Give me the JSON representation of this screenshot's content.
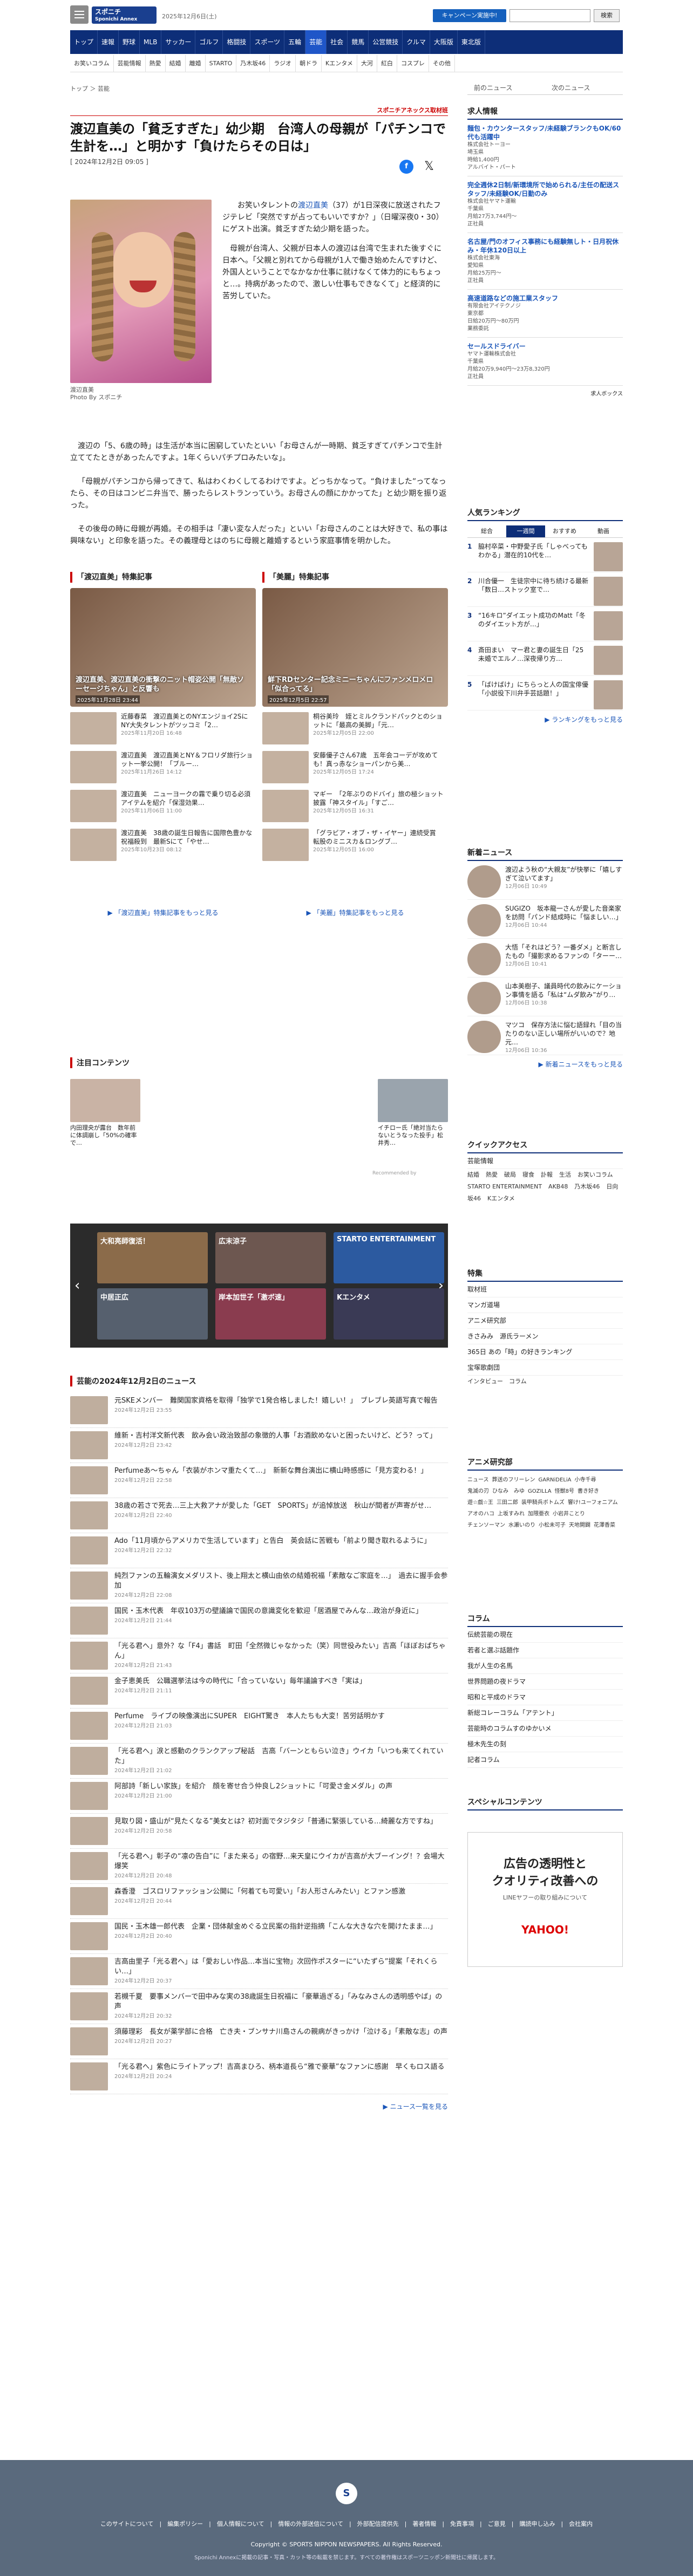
{
  "header": {
    "logo": "スポニチ",
    "logo_sub": "Sponichi Annex",
    "date": "2025年12月6日(土)",
    "campaign": "キャンペーン実施中!",
    "search_btn": "検索"
  },
  "nav1": [
    "トップ",
    "速報",
    "野球",
    "MLB",
    "サッカー",
    "ゴルフ",
    "格闘技",
    "スポーツ",
    "五輪",
    "芸能",
    "社会",
    "競馬",
    "公営競技",
    "クルマ",
    "大阪版",
    "東北版"
  ],
  "nav2": [
    "お笑いコラム",
    "芸能情報",
    "熱愛",
    "結婚",
    "離婚",
    "STARTO",
    "乃木坂46",
    "ラジオ",
    "朝ドラ",
    "Kエンタメ",
    "大河",
    "紅白",
    "コスプレ",
    "その他"
  ],
  "crumb": "トップ ＞ 芸能",
  "side_tabs": {
    "a": "前のニュース",
    "b": "次のニュース"
  },
  "article": {
    "tag": "スポニチアネックス取材班",
    "title": "渡辺直美の「貧乏すぎた」幼少期　台湾人の母親が「パチンコで生計を…」と明かす「負けたらその日は」",
    "date": "[ 2024年12月2日 09:05 ]",
    "caption1": "渡辺直美",
    "caption2": "Photo By スポニチ",
    "lead1a": "　お笑いタレントの",
    "lead1link": "渡辺直美",
    "lead1b": "（37）が1日深夜に放送されたフジテレビ「突然ですが占ってもいいですか？」（日曜深夜0・30）にゲスト出演。貧乏すぎた幼少期を語った。",
    "lead2": "母親が台湾人、父親が日本人の渡辺は台湾で生まれた後すぐに日本へ。「父親と別れてから母親が1人で働き始めたんですけど、外国人ということでなかなか仕事に就けなくて体力的にもちょっと…。持病があったので、激しい仕事もできなくて」と経済的に苦労していた。",
    "p1": "渡辺の「5、6歳の時」は生活が本当に困窮していたといい「お母さんが一時期、貧乏すぎてパチンコで生計立ててたときがあったんですよ。1年くらいパチプロみたいな」。",
    "p2": "「母親がパチンコから帰ってきて、私はわくわくしてるわけですよ。どっちかなって。“負けました”ってなったら、その日はコンビニ弁当で、勝ったらレストランっていう。お母さんの顔にかかってた」と幼少期を振り返った。",
    "p3": "その後母の時に母親が再婚。その相手は「凄い変な人だった」といい「お母さんのことは大好きで、私の事は興味ない」と印象を語った。その義理母とはのちに母親と離婚するという家庭事情を明かした。",
    "tag2": "スポニチアネックス取材班"
  },
  "feature_left": {
    "title": "「渡辺直美」特集記事",
    "hero": "渡辺直美、渡辺直美の衝撃のニット帽姿公開「無敵ソーセージちゃん」と反響も",
    "hero_date": "2025年11月28日 23:44",
    "items": [
      {
        "t": "近藤春菜　渡辺直美とのNYエンジョイ2SにNY大失タレントがツッコミ「2…",
        "d": "2025年11月20日 16:48"
      },
      {
        "t": "渡辺直美　渡辺直美とNY＆フロリダ旅行ショット一挙公開！「ブルー…",
        "d": "2025年11月26日 14:12"
      },
      {
        "t": "渡辺直美　ニューヨークの霧で乗り切る必須アイテムを紹介「保湿効果…",
        "d": "2025年11月06日 11:00"
      },
      {
        "t": "渡辺直美　38歳の誕生日報告に国際色豊かな祝福殺到　最新Sにて「やせ…",
        "d": "2025年10月23日 08:12"
      }
    ],
    "more": "「渡辺直美」特集記事をもっと見る"
  },
  "feature_right": {
    "title": "「美麗」特集記事",
    "hero": "鮮下RDセンター記念ミニーちゃんにファンメロメロ「似合ってる」",
    "hero_date": "2025年12月5日 22:57",
    "items": [
      {
        "t": "桐谷美玲　姪とミルクランドパックとのショットに「最高の美脚」「元…",
        "d": "2025年12月05日 22:00"
      },
      {
        "t": "安藤優子さん67歳　五年会コーデが攻めても！真っ赤なショーパンから美…",
        "d": "2025年12月05日 17:24"
      },
      {
        "t": "マギー　「2年ぶりのドバイ」旅の極ショット披露「神スタイル」「すご…",
        "d": "2025年12月05日 16:31"
      },
      {
        "t": "「グラビア・オブ・ザ・イヤー」連続受賞　転股のミニスカ＆ロングブ…",
        "d": "2025年12月05日 16:00"
      }
    ],
    "more": "「美麗」特集記事をもっと見る"
  },
  "notice": {
    "title": "注目コンテンツ",
    "a": "内田理央が露台　数年前に体調崩し「50%の確率で…",
    "b": "イチロー氏「絶対当たらないとうなった投手」松井秀…",
    "rec": "Recommended by"
  },
  "carousel": [
    "大和亮師復活！",
    "広末涼子",
    "STARTO ENTERTAINMENT",
    "中居正広",
    "岸本加世子「激ボ速」",
    "Kエンタメ"
  ],
  "news": {
    "title": "芸能の2024年12月2日のニュース",
    "items": [
      {
        "t": "元SKEメンバー　難関国家資格を取得「独学で1発合格しました！嬉しい！」　ブレブレ英語写真で報告",
        "d": "2024年12月2日 23:55"
      },
      {
        "t": "維新・吉村洋文新代表　飲み会い政治致部の象徴的人事「お酒飲めないと困ったいけど、どう？って」",
        "d": "2024年12月2日 23:42"
      },
      {
        "t": "Perfumeあ～ちゃん「衣装がホンマ重たくて…」　新新な舞台演出に横山時感感に「見方変わる！」",
        "d": "2024年12月2日 22:58"
      },
      {
        "t": "38歳の若さで死去…三上大救アナが愛した「GET　SPORTS」が追悼放送　秋山が間者が声寄がせ…",
        "d": "2024年12月2日 22:40"
      },
      {
        "t": "Ado「11月頃からアメリカで生活しています」と告白　英会話に苦戦も「前より聞き取れるように」",
        "d": "2024年12月2日 22:32"
      },
      {
        "t": "純烈ファンの五輪演女メダリスト、後上翔太と横山由依の結婚祝福「素敵なご家庭を…」　過去に握手会参加",
        "d": "2024年12月2日 22:08"
      },
      {
        "t": "国民・玉木代表　年収103万の壁議論で国民の意識変化を歓迎「居酒屋でみんな…政治が身近に」",
        "d": "2024年12月2日 21:44"
      },
      {
        "t": "「光る君へ」意外？な「F4」書話　町田「全然微じゃなかった（笑）同世役みたい」吉高「ほぼおばちゃん」",
        "d": "2024年12月2日 21:43"
      },
      {
        "t": "金子恵美氏　公職選挙法は今の時代に「合っていない」毎年議論すべき「実は」",
        "d": "2024年12月2日 21:11"
      },
      {
        "t": "Perfume　ライブの映像演出にSUPER　EIGHT驚き　本人たちも大変！苦労話明かす",
        "d": "2024年12月2日 21:03"
      },
      {
        "t": "「光る君へ」涙と感動のクランクアップ秘話　吉高「バーンともらい泣き」ウイカ「いつも来てくれていた」",
        "d": "2024年12月2日 21:02"
      },
      {
        "t": "阿部詩「新しい家族」を紹介　顔を寄せ合う仲良し2ショットに「可愛さ金メダル」の声",
        "d": "2024年12月2日 21:00"
      },
      {
        "t": "見取り図・盛山が“見たくなる”美女とは？初対面でタジタジ「普通に緊張している…綺麗な方ですね」",
        "d": "2024年12月2日 20:58"
      },
      {
        "t": "「光る君へ」彰子の“凛の告白”に「また来る」の宿野…来天皇にウイカが吉高が大ブーイング！？会場大爆笑",
        "d": "2024年12月2日 20:48"
      },
      {
        "t": "森香澄　ゴスロリファッション公開に「何着ても可愛い」「お人形さんみたい」とファン感激",
        "d": "2024年12月2日 20:44"
      },
      {
        "t": "国民・玉木雄一郎代表　企業・団体献金めぐる立民案の指針逆指摘「こんな大きな穴を開けたまま…」",
        "d": "2024年12月2日 20:40"
      },
      {
        "t": "吉高由里子「光る君へ」は「愛おしい作品…本当に宝物」次回作ポスターに“いたずら”提案「それくらい…」",
        "d": "2024年12月2日 20:37"
      },
      {
        "t": "若槻千夏　要事メンバーで田中みな実の38歳誕生日祝福に「豪華過ぎる」「みなみさんの透明感やば」の声",
        "d": "2024年12月2日 20:32"
      },
      {
        "t": "須藤理彩　長女が薬学部に合格　亡き夫・ブンサナ川島さんの親病がきっかけ「泣ける」「素敵な志」の声",
        "d": "2024年12月2日 20:27"
      },
      {
        "t": "「光る君へ」紫色にライトアップ！吉高まひろ、柄本道長ら“雅で豪華”なファンに感謝　早くもロス語る",
        "d": "2024年12月2日 20:24"
      }
    ],
    "more": "ニュース一覧を見る"
  },
  "jobs": {
    "title": "求人情報",
    "items": [
      {
        "t": "麺包・カウンタースタッフ/未経験ブランクもOK/60代も活躍中",
        "c": "株式会社トーヨー",
        "l": "埼玉県",
        "s": "時給1,400円",
        "e": "アルバイト・パート"
      },
      {
        "t": "完全週休2日制/新環境所で始められる/主任の配送スタッフ/未経験OK/日勤のみ",
        "c": "株式会社ヤマト運輸",
        "l": "千葉県",
        "s": "月給27万3,744円〜",
        "e": "正社員"
      },
      {
        "t": "名古屋/門のオフィス事務にも経験無しト・日月祝休み・年休120日以上",
        "c": "株式会社東海",
        "l": "愛知県",
        "s": "月給25万円〜",
        "e": "正社員"
      },
      {
        "t": "高速道路などの施工業スタッフ",
        "c": "有限会社アイテクノジ",
        "l": "東京都",
        "s": "日給20万円〜80万円",
        "e": "業務委託"
      },
      {
        "t": "セールスドライバー",
        "c": "ヤマト運輸株式会社",
        "l": "千葉県",
        "s": "月給20万9,940円〜23万8,320円",
        "e": "正社員"
      }
    ],
    "footer": "求人ボックス"
  },
  "ranking": {
    "title": "人気ランキング",
    "tabs": [
      "総合",
      "一週間",
      "おすすめ",
      "動画"
    ],
    "items": [
      {
        "n": "1",
        "t": "脇村卒菜・中野愛子氏「しゃべってもわかる」潜在的10代を…"
      },
      {
        "n": "2",
        "t": "川合優一　生徒宗中に待ち続ける最新「数日…ストック室で…"
      },
      {
        "n": "3",
        "t": "“16キロ”ダイエット成功のMatt「冬のダイエット方が…」"
      },
      {
        "n": "4",
        "t": "斎田まい　マー君と妻の誕生日「25　未婚でエルノ…深夜帰り方…"
      },
      {
        "n": "5",
        "t": "「ばけばけ」にちらっと人の国宝俳優「小説役下川弁手芸話題！」"
      }
    ],
    "more": "ランキングをもっと見る"
  },
  "newarrival": {
    "title": "新着ニュース",
    "items": [
      {
        "t": "渡辺よう秋の“大親友”が快挙に「嬉しすぎて泣いてます」",
        "d": "12月06日 10:49"
      },
      {
        "t": "SUGIZO　坂本龍一さんが愛した音楽家を訪問「パンド結成時に「悩ましい…」",
        "d": "12月06日 10:44"
      },
      {
        "t": "大悟「それはどう？一番ダメ」と断言したもの「撮影求めるファンの「ターー…",
        "d": "12月06日 10:41"
      },
      {
        "t": "山本美樹子、議員時代の飲みにケーション事情を語る「私は“ムダ飲み”がり…",
        "d": "12月06日 10:38"
      },
      {
        "t": "マツコ　保存方法に悩む語録れ「目の当たりのない正しい場所がいいので？地元…",
        "d": "12月06日 10:36"
      }
    ],
    "more": "新着ニュースをもっと見る"
  },
  "quick": {
    "title": "クイックアクセス",
    "head": "芸能情報",
    "links": [
      "結婚",
      "熱愛",
      "破局",
      "寝食",
      "訃報",
      "生活",
      "お笑いコラム"
    ],
    "tags": [
      "STARTO ENTERTAINMENT",
      "AKB48",
      "乃木坂46",
      "日向坂46",
      "Kエンタメ"
    ]
  },
  "special": {
    "title": "特集",
    "items": [
      "取材班",
      "マンガ道場",
      "アニメ研究部",
      "きさみみ　源氏ラーメン",
      "365日 あの「時」の好きランキング",
      "宝塚歌劇団"
    ],
    "more": "インタビュー　コラム"
  },
  "anime": {
    "title": "アニメ研究部",
    "links": [
      "ニュース",
      "葬送のフリーレン",
      "GARNiDELiA",
      "小寺千尋",
      "鬼滅の刃",
      "ひなみ　みゆ",
      "GOZILLA",
      "怪獣8号",
      "書き好き",
      "遊☆戯☆王",
      "三田二郎",
      "装甲騎兵ボトムズ",
      "響け!ユーフォニアム",
      "アオのハコ",
      "上坂すみれ",
      "加隈亜衣",
      "小岩井ことり",
      "チェンソーマン",
      "水瀬いのり",
      "小松未可子",
      "天地開闢",
      "花澤香菜"
    ]
  },
  "column": {
    "title": "コラム",
    "items": [
      "伝統芸能の現在",
      "若者と選ぶ話題作",
      "我が人生の名馬",
      "世界問題の夜ドラマ",
      "昭和と平成のドラマ",
      "新総コレーコラム「アテント」",
      "芸能時のコラムすのゆかいメ",
      "極木先生の刻",
      "記者コラム"
    ]
  },
  "specialcontents": {
    "title": "スペシャルコンテンツ",
    "ad1": "広告の透明性と",
    "ad2": "クオリティ改善への",
    "ad3": "LINEヤフーの取り組みについて",
    "ad_brand": "YAHOO!"
  },
  "footer": {
    "logo": "S",
    "links": "このサイトについて　|　編集ポリシー　|　個人情報について　|　情報の外部送信について　|　外部配信提供先　|　著者情報　|　免責事項　|　ご意見　|　購読申し込み　|　会社案内",
    "copyright": "Copyright © SPORTS NIPPON NEWSPAPERS. All Rights Reserved.",
    "note": "Sponichi Annexに掲載の記事・写真・カット等の転載を禁じます。すべての著作権はスポーツニッポン新聞社に帰属します。"
  },
  "colors": {
    "navy": "#0d2e78",
    "accent": "#c00000",
    "link": "#1a55b8"
  }
}
